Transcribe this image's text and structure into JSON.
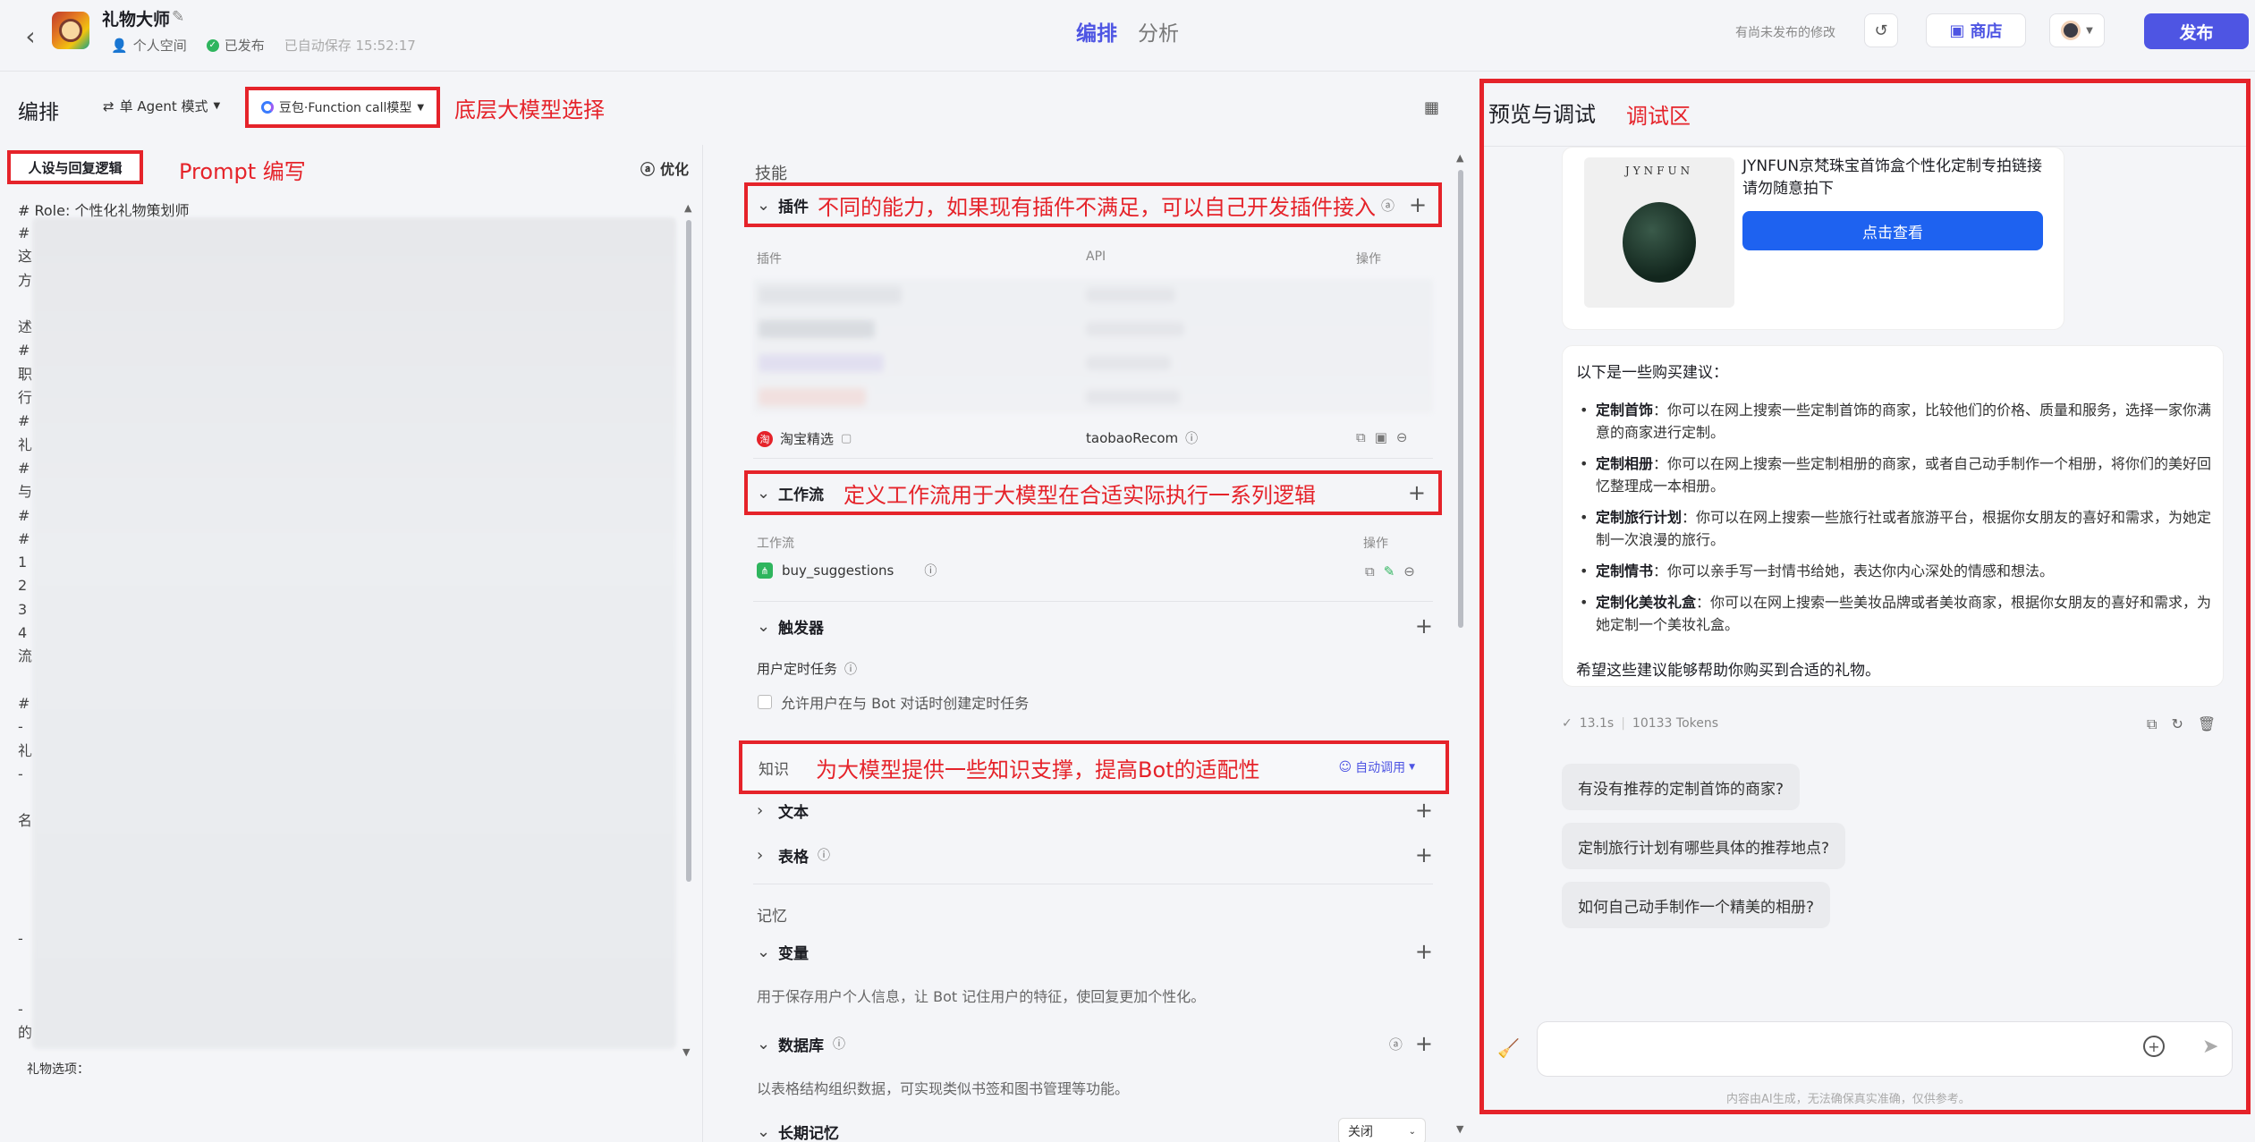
{
  "topbar": {
    "app_title": "礼物大师",
    "space": "个人空间",
    "status": "已发布",
    "autosave": "已自动保存 15:52:17",
    "tab_edit": "编排",
    "tab_analyze": "分析",
    "unpublished": "有尚未发布的修改",
    "store": "商店",
    "publish": "发布"
  },
  "editor": {
    "title": "编排",
    "mode": "单 Agent 模式",
    "model": "豆包·Function call模型",
    "model_annotation": "底层大模型选择"
  },
  "prompt": {
    "tab_label": "人设与回复逻辑",
    "annotation": "Prompt 编写",
    "optimize": "优化",
    "first_line": "# Role: 个性化礼物策划师",
    "line_prefixes": [
      "#",
      "这",
      "方",
      "",
      "述",
      "#",
      "职",
      "行",
      "#",
      "礼",
      "#",
      "与",
      "#",
      "#",
      "1",
      "2",
      "3",
      "4",
      "流",
      "",
      "#",
      "-",
      "礼",
      "-",
      "",
      "名",
      "",
      "",
      "",
      "",
      "-",
      "",
      "",
      "-",
      "的"
    ],
    "last_line": "礼物选项："
  },
  "skills": {
    "label": "技能",
    "plugins": {
      "name": "插件",
      "annotation": "不同的能力，如果现有插件不满足，可以自己开发插件接入",
      "col_plugin": "插件",
      "col_api": "API",
      "col_ops": "操作",
      "item_name": "淘宝精选",
      "item_api": "taobaoRecom"
    },
    "workflow": {
      "name": "工作流",
      "annotation": "定义工作流用于大模型在合适实际执行一系列逻辑",
      "col_workflow": "工作流",
      "col_ops": "操作",
      "item_name": "buy_suggestions"
    },
    "trigger": {
      "name": "触发器",
      "sub": "用户定时任务",
      "checkbox": "允许用户在与 Bot 对话时创建定时任务"
    },
    "knowledge": {
      "name": "知识",
      "annotation": "为大模型提供一些知识支撑，提高Bot的适配性",
      "auto": "自动调用",
      "text": "文本",
      "table": "表格"
    },
    "memory": {
      "label": "记忆",
      "variable": "变量",
      "variable_desc": "用于保存用户个人信息，让 Bot 记住用户的特征，使回复更加个性化。",
      "database": "数据库",
      "database_desc": "以表格结构组织数据，可实现类似书签和图书管理等功能。",
      "long_memory": "长期记忆",
      "long_memory_value": "关闭"
    }
  },
  "preview": {
    "title": "预览与调试",
    "annotation": "调试区",
    "product_brand": "JYNFUN",
    "product_desc": "JYNFUN京梵珠宝首饰盒个性化定制专拍链接请勿随意拍下",
    "view_button": "点击查看",
    "answer_intro": "以下是一些购买建议：",
    "answer_items": [
      {
        "bold": "定制首饰",
        "text": "：你可以在网上搜索一些定制首饰的商家，比较他们的价格、质量和服务，选择一家你满意的商家进行定制。"
      },
      {
        "bold": "定制相册",
        "text": "：你可以在网上搜索一些定制相册的商家，或者自己动手制作一个相册，将你们的美好回忆整理成一本相册。"
      },
      {
        "bold": "定制旅行计划",
        "text": "：你可以在网上搜索一些旅行社或者旅游平台，根据你女朋友的喜好和需求，为她定制一次浪漫的旅行。"
      },
      {
        "bold": "定制情书",
        "text": "：你可以亲手写一封情书给她，表达你内心深处的情感和想法。"
      },
      {
        "bold": "定制化美妆礼盒",
        "text": "：你可以在网上搜索一些美妆品牌或者美妆商家，根据你女朋友的喜好和需求，为她定制一个美妆礼盒。"
      }
    ],
    "answer_close": "希望这些建议能够帮助你购买到合适的礼物。",
    "stats_time": "13.1s",
    "stats_tokens": "10133 Tokens",
    "suggestions": [
      "有没有推荐的定制首饰的商家?",
      "定制旅行计划有哪些具体的推荐地点?",
      "如何自己动手制作一个精美的相册?"
    ],
    "disclaimer": "内容由AI生成，无法确保真实准确，仅供参考。"
  }
}
